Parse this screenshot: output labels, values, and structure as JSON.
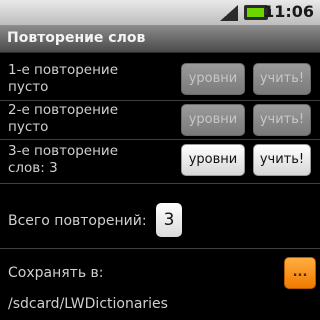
{
  "status_bar": {
    "time": "11:06",
    "signal_icon": "signal-icon",
    "battery_icon": "battery-icon"
  },
  "app": {
    "title": "Повторение слов"
  },
  "repetitions": [
    {
      "label_line1": "1-е повторение",
      "label_line2": "пусто",
      "levels_label": "уровни",
      "learn_label": "учить!",
      "enabled": false
    },
    {
      "label_line1": "2-е повторение",
      "label_line2": "пусто",
      "levels_label": "уровни",
      "learn_label": "учить!",
      "enabled": false
    },
    {
      "label_line1": "3-е повторение",
      "label_line2": "слов: 3",
      "levels_label": "уровни",
      "learn_label": "учить!",
      "enabled": true
    }
  ],
  "total": {
    "label": "Всего повторений:",
    "value": "3"
  },
  "save": {
    "label": "Сохранять в:",
    "browse_label": "...",
    "path": "/sdcard/LWDictionaries"
  },
  "colors": {
    "background": "#000000",
    "browse_button": "#f07a00"
  }
}
